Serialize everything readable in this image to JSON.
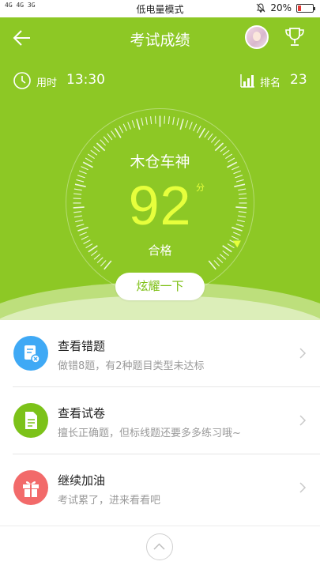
{
  "status_bar": {
    "network": "4G 4G 3G",
    "mode_text": "低电量模式",
    "battery_text": "20%",
    "battery_level": 0.2,
    "battery_color": "#e53935"
  },
  "header": {
    "title": "考试成绩",
    "back_icon": "arrow-left-icon",
    "trophy_icon": "trophy-icon",
    "background_color": "#8dc825"
  },
  "stats": {
    "time_label": "用时",
    "time_value": "13:30",
    "rank_label": "排名",
    "rank_value": "23"
  },
  "result": {
    "name": "木仓车神",
    "score": "92",
    "score_unit": "分",
    "status": "合格",
    "score_color": "#e6ff3c",
    "share_button": "炫耀一下"
  },
  "list": [
    {
      "title": "查看错题",
      "subtitle": "做错8题，有2种题目类型未达标",
      "icon": "wrong-questions-icon",
      "color": "#3fa9f5"
    },
    {
      "title": "查看试卷",
      "subtitle": "擅长正确题，但标线题还要多多练习哦~",
      "icon": "document-icon",
      "color": "#7cc219"
    },
    {
      "title": "继续加油",
      "subtitle": "考试累了，进来看看吧",
      "icon": "gift-icon",
      "color": "#f26a6a"
    }
  ]
}
